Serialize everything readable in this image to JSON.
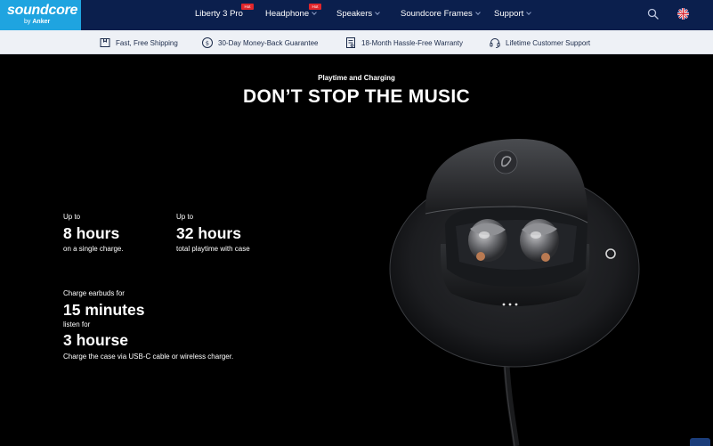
{
  "brand": {
    "name": "soundcore",
    "sub_prefix": "by",
    "sub_brand": "Anker"
  },
  "nav": {
    "items": [
      {
        "label": "Liberty 3 Pro",
        "badge": "Hot",
        "has_chevron": false
      },
      {
        "label": "Headphone",
        "badge": "Hot",
        "has_chevron": true
      },
      {
        "label": "Speakers",
        "badge": "",
        "has_chevron": true
      },
      {
        "label": "Soundcore Frames",
        "badge": "",
        "has_chevron": true
      },
      {
        "label": "Support",
        "badge": "",
        "has_chevron": true
      }
    ],
    "search_icon": "search-icon",
    "flag_icon": "uk-flag-icon"
  },
  "benefits": [
    {
      "icon": "package-icon",
      "label": "Fast, Free Shipping"
    },
    {
      "icon": "money-back-icon",
      "label": "30-Day Money-Back Guarantee"
    },
    {
      "icon": "warranty-icon",
      "label": "18-Month Hassle-Free Warranty"
    },
    {
      "icon": "headset-icon",
      "label": "Lifetime Customer Support"
    }
  ],
  "hero": {
    "kicker": "Playtime and Charging",
    "headline": "DON’T STOP THE MUSIC",
    "stats": {
      "single": {
        "prefix": "Up to",
        "value": "8 hours",
        "caption": "on a single charge."
      },
      "total": {
        "prefix": "Up to",
        "value": "32 hours",
        "caption": "total playtime with case"
      },
      "charge": {
        "prefix": "Charge earbuds for",
        "value": "15 minutes",
        "middle": "listen for",
        "result": "3 hourse",
        "caption": "Charge the case via USB-C cable or wireless charger."
      }
    }
  },
  "colors": {
    "nav_bg": "#0b1f4d",
    "logo_bg": "#1fa4e0",
    "hot_badge": "#e0262b",
    "benefits_bg": "#eef1f6",
    "hero_bg": "#000000"
  }
}
